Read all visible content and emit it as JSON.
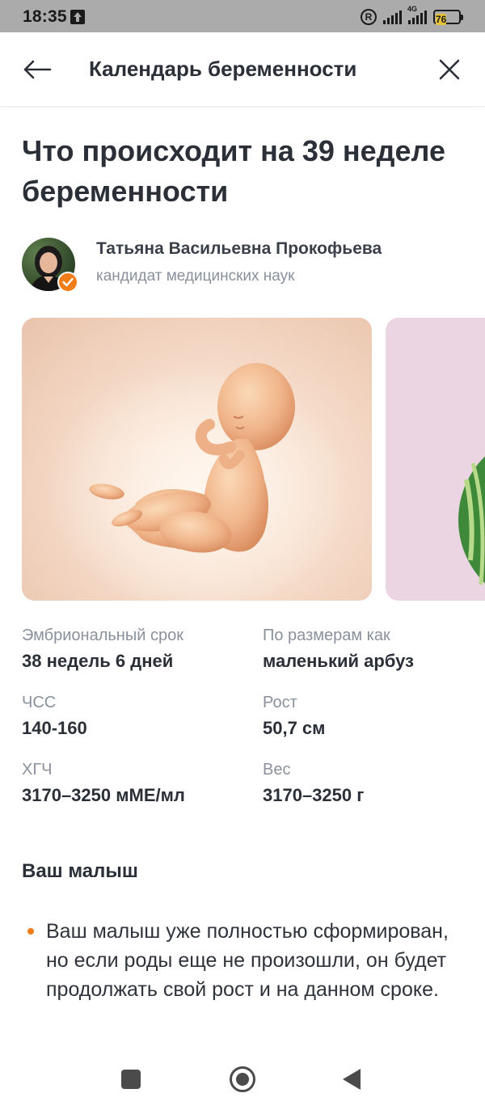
{
  "status_bar": {
    "time": "18:35",
    "network_label": "4G",
    "battery_level": "76",
    "icons": [
      "upload-icon",
      "registered-icon",
      "signal-icon",
      "signal-4g-icon",
      "battery-icon"
    ]
  },
  "header": {
    "title": "Календарь беременности",
    "back_icon": "arrow-left-icon",
    "close_icon": "close-icon"
  },
  "article": {
    "title": "Что происходит на 39 неделе беременности",
    "author": {
      "name": "Татьяна Васильевна Прокофьева",
      "degree": "кандидат медицинских наук",
      "badge_icon": "check-icon"
    },
    "carousel": {
      "slides": [
        "fetus-illustration",
        "watermelon-illustration"
      ]
    },
    "facts": [
      {
        "label": "Эмбриональный срок",
        "value": "38 недель 6 дней"
      },
      {
        "label": "По размерам как",
        "value": "маленький арбуз"
      },
      {
        "label": "ЧСС",
        "value": "140-160"
      },
      {
        "label": "Рост",
        "value": "50,7 см"
      },
      {
        "label": "ХГЧ",
        "value": "3170–3250 мМЕ/мл"
      },
      {
        "label": "Вес",
        "value": "3170–3250 г"
      }
    ],
    "section": {
      "title": "Ваш малыш",
      "bullets": [
        "Ваш малыш уже полностью сформирован, но если роды еще не произошли, он будет продолжать свой рост и на данном сроке."
      ]
    }
  },
  "colors": {
    "accent": "#f07c1a",
    "text": "#2b2f38",
    "muted": "#8a919c",
    "status_bar": "#ababab"
  }
}
